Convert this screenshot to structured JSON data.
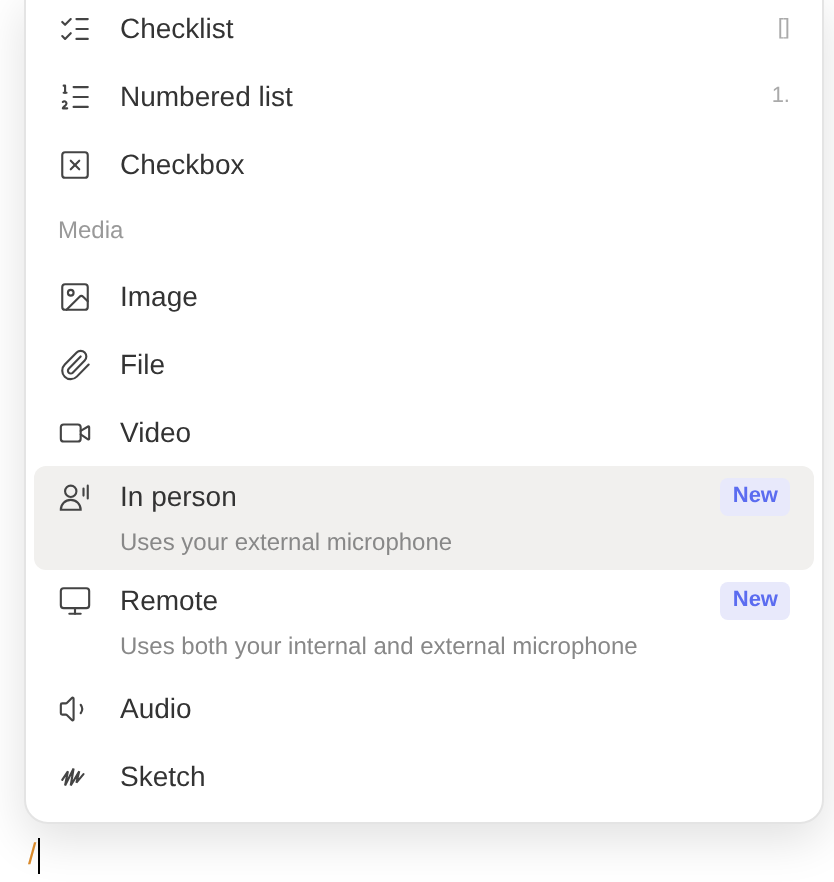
{
  "menu": {
    "items": [
      {
        "kind": "item",
        "label": "Checklist",
        "shortcut": "[]",
        "selected": false
      },
      {
        "kind": "item",
        "label": "Numbered list",
        "shortcut": "1.",
        "selected": false
      },
      {
        "kind": "item",
        "label": "Checkbox",
        "selected": false
      },
      {
        "kind": "header",
        "label": "Media"
      },
      {
        "kind": "item",
        "label": "Image",
        "selected": false
      },
      {
        "kind": "item",
        "label": "File",
        "selected": false
      },
      {
        "kind": "item",
        "label": "Video",
        "selected": false
      },
      {
        "kind": "item",
        "label": "In person",
        "badge": "New",
        "description": "Uses your external microphone",
        "selected": true
      },
      {
        "kind": "item",
        "label": "Remote",
        "badge": "New",
        "description": "Uses both your internal and external microphone",
        "selected": false
      },
      {
        "kind": "item",
        "label": "Audio",
        "selected": false
      },
      {
        "kind": "item",
        "label": "Sketch",
        "selected": false
      }
    ]
  },
  "editor": {
    "text": "/"
  }
}
